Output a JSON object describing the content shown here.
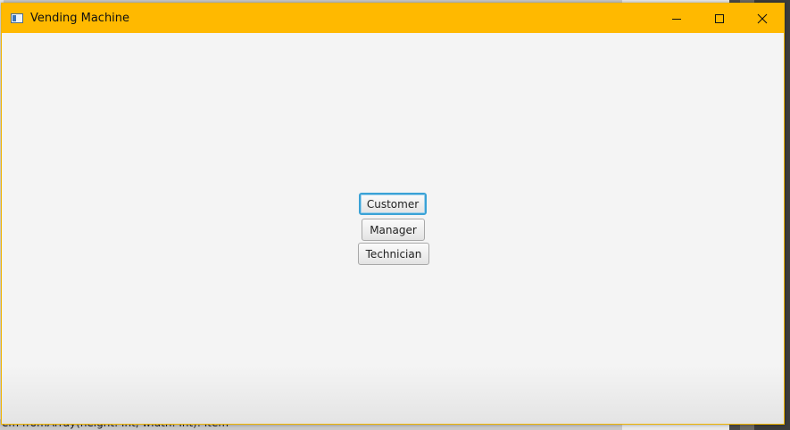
{
  "window": {
    "title": "Vending Machine",
    "accent_color": "#ffb900",
    "controls": {
      "minimize_icon": "minimize-icon",
      "maximize_icon": "maximize-icon",
      "close_icon": "close-icon"
    }
  },
  "buttons": {
    "customer": "Customer",
    "manager": "Manager",
    "technician": "Technician"
  },
  "background": {
    "code_fragment": "em fromArray(height: Int, width: Int): Item"
  }
}
